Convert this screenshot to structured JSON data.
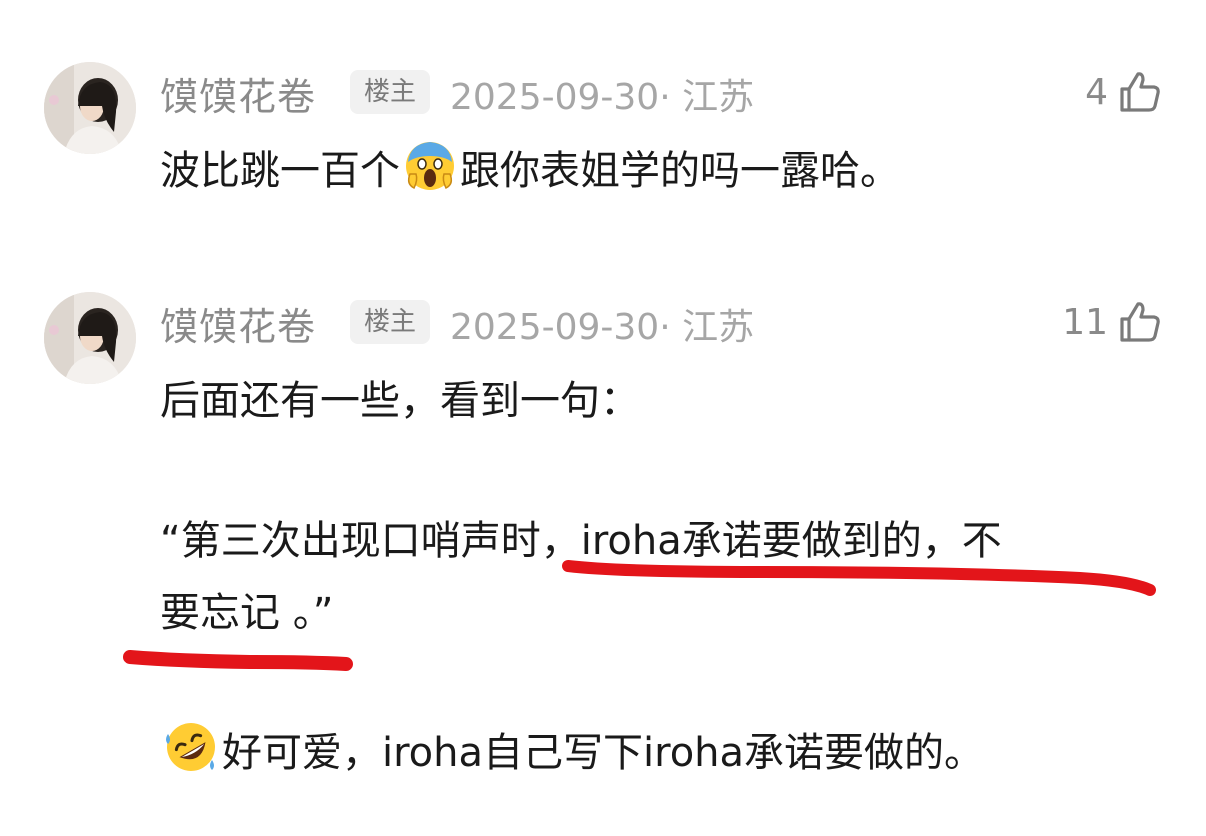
{
  "comments": [
    {
      "username": "馍馍花卷",
      "op_badge": "楼主",
      "meta": "2025-09-30· 江苏",
      "likes": "4",
      "text": {
        "before_emoji": "波比跳一百个",
        "emoji": "screaming-face-emoji",
        "after_emoji": "跟你表姐学的吗一露哈。"
      }
    },
    {
      "username": "馍馍花卷",
      "op_badge": "楼主",
      "meta": "2025-09-30· 江苏",
      "likes": "11",
      "text": {
        "line1": "后面还有一些，看到一句：",
        "line2": "“第三次出现口哨声时，iroha承诺要做到的，不",
        "line3": "要忘记 。”",
        "line4_emoji": "rolling-on-floor-laughing-emoji",
        "line4": "好可爱，iroha自己写下iroha承诺要做的。"
      }
    }
  ],
  "colors": {
    "underline": "#e3151a",
    "text": "#1a1a1a",
    "meta": "#a6a6a6"
  }
}
